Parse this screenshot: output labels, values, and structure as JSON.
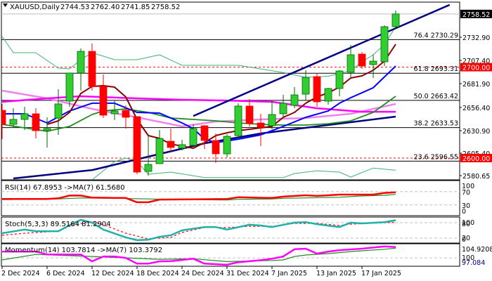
{
  "header": {
    "symbol_label": "XAUUSD,Daily",
    "open": "2744.53",
    "high": "2762.40",
    "low": "2741.85",
    "close": "2758.52"
  },
  "colors": {
    "bull": "#32cd32",
    "bull_edge": "#006400",
    "bear": "#ff0000",
    "ma_fast": "#8b0000",
    "ma_blue": "#0000ff",
    "ma_green": "#228b22",
    "ma_magenta": "#ff00ff",
    "ma_violet": "#ee82ee",
    "navy": "#000080",
    "band": "#3cb371",
    "rsi": "#ff0000",
    "stoch": "#20b2aa",
    "momentum": "#ff00ff"
  },
  "price_axis": {
    "labels": [
      "2732.90",
      "2707.40",
      "2681.90",
      "2656.40",
      "2630.90",
      "2605.40",
      "2580.65"
    ],
    "current_price": "2758.52",
    "level_2700": "2700.00",
    "level_2600": "2600.00"
  },
  "fibonacci": [
    {
      "label": "76.4 2730.29",
      "price": 2730.29
    },
    {
      "label": "61.8 2693.31",
      "price": 2693.31
    },
    {
      "label": "50.0 2663.42",
      "price": 2663.42
    },
    {
      "label": "38.2 2633.53",
      "price": 2633.53
    },
    {
      "label": "23.6 2596.55",
      "price": 2596.55
    }
  ],
  "candles": [
    [
      2652.5,
      2659.5,
      2620.8,
      2637.1
    ],
    [
      2637.1,
      2654.8,
      2633.2,
      2642.5
    ],
    [
      2642.5,
      2656.4,
      2630.9,
      2648.7
    ],
    [
      2648.7,
      2654.8,
      2621.6,
      2630.1
    ],
    [
      2630.1,
      2644.8,
      2611.6,
      2632.4
    ],
    [
      2644.0,
      2675.7,
      2625.5,
      2659.5
    ],
    [
      2662.6,
      2693.5,
      2656.4,
      2693.5
    ],
    [
      2693.5,
      2720.5,
      2674.2,
      2717.4
    ],
    [
      2717.4,
      2725.9,
      2674.2,
      2678.8
    ],
    [
      2678.8,
      2691.9,
      2644.0,
      2647.1
    ],
    [
      2648.7,
      2663.3,
      2641.7,
      2651.8
    ],
    [
      2652.5,
      2657.9,
      2632.4,
      2644.8
    ],
    [
      2645.6,
      2645.6,
      2582.2,
      2584.5
    ],
    [
      2585.3,
      2624.7,
      2580.7,
      2593.0
    ],
    [
      2593.8,
      2630.9,
      2593.8,
      2621.6
    ],
    [
      2618.5,
      2632.4,
      2606.2,
      2611.6
    ],
    [
      2610.8,
      2620.1,
      2608.5,
      2614.7
    ],
    [
      2613.9,
      2637.1,
      2613.9,
      2632.4
    ],
    [
      2635.5,
      2636.3,
      2610.0,
      2619.3
    ],
    [
      2619.3,
      2627.0,
      2594.6,
      2604.6
    ],
    [
      2604.6,
      2626.3,
      2600.8,
      2623.9
    ],
    [
      2624.7,
      2660.3,
      2620.8,
      2657.2
    ],
    [
      2657.2,
      2664.9,
      2634.8,
      2637.8
    ],
    [
      2638.6,
      2648.7,
      2613.1,
      2634.0
    ],
    [
      2635.5,
      2663.3,
      2631.7,
      2647.9
    ],
    [
      2648.7,
      2669.5,
      2644.0,
      2660.3
    ],
    [
      2657.9,
      2678.0,
      2654.8,
      2669.5
    ],
    [
      2670.3,
      2696.6,
      2663.3,
      2688.8
    ],
    [
      2689.6,
      2692.7,
      2656.4,
      2661.8
    ],
    [
      2662.6,
      2677.3,
      2658.7,
      2676.5
    ],
    [
      2676.5,
      2696.6,
      2668.0,
      2695.8
    ],
    [
      2694.3,
      2724.4,
      2688.8,
      2713.6
    ],
    [
      2714.4,
      2716.7,
      2698.1,
      2701.2
    ],
    [
      2702.8,
      2713.6,
      2688.1,
      2706.6
    ],
    [
      2705.9,
      2746.0,
      2701.2,
      2744.5
    ],
    [
      2744.53,
      2762.4,
      2741.85,
      2758.52
    ]
  ],
  "overlays": {
    "ma_fast": [
      [
        4,
        2637.1
      ],
      [
        5,
        2640.9
      ],
      [
        6,
        2650.2
      ],
      [
        7,
        2671.1
      ],
      [
        8,
        2678.8
      ],
      [
        9,
        2679.6
      ],
      [
        10,
        2678.0
      ],
      [
        11,
        2667.2
      ],
      [
        12,
        2642.5
      ],
      [
        13,
        2624.7
      ],
      [
        14,
        2621.6
      ],
      [
        15,
        2615.4
      ],
      [
        16,
        2613.1
      ],
      [
        17,
        2610.8
      ],
      [
        18,
        2617.0
      ],
      [
        19,
        2624.7
      ],
      [
        20,
        2627.8
      ],
      [
        21,
        2630.1
      ],
      [
        22,
        2631.7
      ],
      [
        23,
        2633.2
      ],
      [
        24,
        2634.8
      ],
      [
        25,
        2644.8
      ],
      [
        26,
        2650.2
      ],
      [
        27,
        2660.3
      ],
      [
        28,
        2667.2
      ],
      [
        29,
        2671.8
      ],
      [
        30,
        2678.0
      ],
      [
        31,
        2688.1
      ],
      [
        32,
        2690.4
      ],
      [
        33,
        2696.6
      ],
      [
        34,
        2706.6
      ],
      [
        35,
        2725.2
      ]
    ],
    "ma_blue": [
      [
        0,
        2648.7
      ],
      [
        2,
        2648.7
      ],
      [
        4,
        2638.6
      ],
      [
        6,
        2651.8
      ],
      [
        8,
        2660.3
      ],
      [
        10,
        2660.3
      ],
      [
        12,
        2650.2
      ],
      [
        14,
        2649.4
      ],
      [
        16,
        2638.6
      ],
      [
        17,
        2632.4
      ],
      [
        18,
        2620.8
      ],
      [
        19,
        2617.0
      ],
      [
        21,
        2620.8
      ],
      [
        23,
        2625.5
      ],
      [
        25,
        2634.8
      ],
      [
        27,
        2644.8
      ],
      [
        29,
        2651.8
      ],
      [
        30,
        2660.3
      ],
      [
        31,
        2666.4
      ],
      [
        33,
        2677.3
      ],
      [
        35,
        2701.2
      ]
    ],
    "ma_green": [
      [
        0,
        2637.1
      ],
      [
        2,
        2633.2
      ],
      [
        4,
        2629.4
      ],
      [
        6,
        2634.8
      ],
      [
        8,
        2647.9
      ],
      [
        9,
        2651.8
      ],
      [
        11,
        2654.1
      ],
      [
        13,
        2650.2
      ],
      [
        15,
        2644.0
      ],
      [
        17,
        2642.5
      ],
      [
        19,
        2640.9
      ],
      [
        21,
        2638.6
      ],
      [
        23,
        2637.1
      ],
      [
        25,
        2636.3
      ],
      [
        27,
        2636.3
      ],
      [
        29,
        2637.8
      ],
      [
        31,
        2640.9
      ],
      [
        33,
        2650.2
      ],
      [
        35,
        2668.0
      ]
    ],
    "ma_magenta": [
      [
        0,
        2661.8
      ],
      [
        4,
        2665.7
      ],
      [
        7,
        2668.0
      ],
      [
        12,
        2665.7
      ],
      [
        16,
        2664.1
      ],
      [
        20,
        2663.3
      ],
      [
        24,
        2661.8
      ],
      [
        28,
        2654.8
      ],
      [
        32,
        2650.9
      ],
      [
        35,
        2650.9
      ]
    ],
    "ma_violet": [
      [
        0,
        2674.2
      ],
      [
        4,
        2665.7
      ],
      [
        8,
        2654.1
      ],
      [
        12,
        2644.8
      ],
      [
        16,
        2634.8
      ],
      [
        19,
        2640.2
      ],
      [
        23,
        2642.5
      ],
      [
        27,
        2644.0
      ],
      [
        31,
        2648.7
      ],
      [
        35,
        2659.5
      ]
    ],
    "navy_ma": [
      [
        1,
        2577.6
      ],
      [
        8,
        2586.8
      ],
      [
        13,
        2601.5
      ],
      [
        18,
        2616.2
      ],
      [
        23,
        2627.0
      ],
      [
        28,
        2634.8
      ],
      [
        35,
        2645.6
      ]
    ],
    "channel_line": [
      [
        17,
        2646.3
      ],
      [
        39.8,
        2768.5
      ]
    ],
    "band_upper": [
      [
        0,
        2733.7
      ],
      [
        1,
        2715.9
      ],
      [
        3,
        2715.9
      ],
      [
        5,
        2698.9
      ],
      [
        6,
        2698.1
      ],
      [
        7,
        2708.2
      ],
      [
        8,
        2715.9
      ],
      [
        10,
        2708.2
      ],
      [
        12,
        2708.2
      ],
      [
        14,
        2713.6
      ],
      [
        16,
        2702.0
      ],
      [
        21,
        2702.0
      ],
      [
        25,
        2694.0
      ],
      [
        27,
        2688.8
      ],
      [
        29,
        2690.0
      ],
      [
        31,
        2696.0
      ],
      [
        32,
        2705.9
      ],
      [
        33,
        2713.6
      ],
      [
        34,
        2725.0
      ],
      [
        35,
        2744.5
      ]
    ],
    "band_lower": [
      [
        8,
        2576.0
      ],
      [
        10,
        2596.0
      ],
      [
        11,
        2600.0
      ],
      [
        12,
        2596.0
      ],
      [
        13,
        2582.2
      ],
      [
        15,
        2584.5
      ],
      [
        18,
        2578.5
      ],
      [
        25,
        2578.5
      ],
      [
        26,
        2583.0
      ],
      [
        28,
        2586.0
      ],
      [
        30,
        2584.5
      ],
      [
        31,
        2579.0
      ],
      [
        33,
        2589.0
      ],
      [
        35,
        2586.5
      ]
    ]
  },
  "rsi": {
    "label": "RSI(14) 67.8953  ->MA(7) 61.5680",
    "scale": [
      "100",
      "70",
      "30",
      "0"
    ],
    "levels": [
      70,
      30
    ],
    "values": [
      [
        0,
        48
      ],
      [
        4,
        48
      ],
      [
        5,
        50
      ],
      [
        6,
        58
      ],
      [
        7,
        58
      ],
      [
        8,
        52
      ],
      [
        10,
        51
      ],
      [
        11,
        51
      ],
      [
        12,
        38
      ],
      [
        13,
        38
      ],
      [
        14,
        46
      ],
      [
        17,
        47
      ],
      [
        20,
        48
      ],
      [
        21,
        53
      ],
      [
        24,
        51
      ],
      [
        25,
        55
      ],
      [
        27,
        59
      ],
      [
        28,
        57
      ],
      [
        29,
        59
      ],
      [
        30,
        61
      ],
      [
        33,
        61
      ],
      [
        34,
        66
      ],
      [
        35,
        67.9
      ]
    ],
    "ma": [
      [
        0,
        46
      ],
      [
        5,
        48
      ],
      [
        7,
        51
      ],
      [
        10,
        50
      ],
      [
        13,
        48
      ],
      [
        16,
        46
      ],
      [
        20,
        45
      ],
      [
        21,
        47
      ],
      [
        24,
        48
      ],
      [
        25,
        50
      ],
      [
        30,
        53
      ],
      [
        32,
        57
      ],
      [
        34,
        59
      ],
      [
        35,
        61.6
      ]
    ]
  },
  "stoch": {
    "label": "Stoch(5,3,3) 89.5164 81.2904",
    "scale": [
      "100",
      "80",
      "20",
      "0"
    ],
    "levels": [
      80,
      20
    ],
    "main": [
      [
        0,
        39
      ],
      [
        2,
        53
      ],
      [
        3,
        47
      ],
      [
        5,
        47
      ],
      [
        6,
        70
      ],
      [
        7,
        91
      ],
      [
        8,
        80
      ],
      [
        9,
        53
      ],
      [
        11,
        23
      ],
      [
        12,
        12
      ],
      [
        13,
        14
      ],
      [
        14,
        25
      ],
      [
        15,
        31
      ],
      [
        16,
        50
      ],
      [
        18,
        63
      ],
      [
        19,
        63
      ],
      [
        20,
        53
      ],
      [
        22,
        72
      ],
      [
        23,
        69
      ],
      [
        24,
        63
      ],
      [
        26,
        80
      ],
      [
        27,
        82
      ],
      [
        28,
        74
      ],
      [
        30,
        63
      ],
      [
        31,
        80
      ],
      [
        32,
        77
      ],
      [
        34,
        82
      ],
      [
        35,
        89.5
      ]
    ],
    "signal": [
      [
        0,
        31
      ],
      [
        2,
        39
      ],
      [
        5,
        47
      ],
      [
        6,
        66
      ],
      [
        8,
        85
      ],
      [
        9,
        72
      ],
      [
        11,
        39
      ],
      [
        13,
        17
      ],
      [
        15,
        23
      ],
      [
        16,
        42
      ],
      [
        18,
        61
      ],
      [
        20,
        61
      ],
      [
        22,
        66
      ],
      [
        24,
        66
      ],
      [
        26,
        77
      ],
      [
        28,
        77
      ],
      [
        30,
        69
      ],
      [
        31,
        74
      ],
      [
        35,
        81.3
      ]
    ]
  },
  "momentum": {
    "label": "Momentum(14) 103.7814  ->MA(7) 103.3792",
    "scale_max": "104.9208",
    "scale_mid": "100",
    "scale_min": "97.084",
    "range": [
      97.084,
      104.9208
    ],
    "values": [
      [
        0,
        102.2
      ],
      [
        3,
        102.2
      ],
      [
        4,
        101.2
      ],
      [
        7,
        101.2
      ],
      [
        8,
        98.8
      ],
      [
        9,
        100.5
      ],
      [
        10,
        100.5
      ],
      [
        11,
        100.0
      ],
      [
        12,
        98.0
      ],
      [
        13,
        98.0
      ],
      [
        14,
        98.8
      ],
      [
        15,
        98.85
      ],
      [
        17,
        99.7
      ],
      [
        18,
        98.0
      ],
      [
        20,
        97.6
      ],
      [
        21,
        98.5
      ],
      [
        23,
        99.2
      ],
      [
        24,
        99.7
      ],
      [
        25,
        100.5
      ],
      [
        26,
        103.0
      ],
      [
        27,
        103.2
      ],
      [
        28,
        101.5
      ],
      [
        29,
        102.2
      ],
      [
        30,
        102.7
      ],
      [
        32,
        103.2
      ],
      [
        34,
        104.0
      ],
      [
        35,
        103.8
      ]
    ],
    "ma": [
      [
        0,
        99.3
      ],
      [
        3,
        101.2
      ],
      [
        8,
        100.5
      ],
      [
        11,
        100
      ],
      [
        14,
        99.5
      ],
      [
        17,
        99.7
      ],
      [
        20,
        98.7
      ],
      [
        24,
        99.1
      ],
      [
        25,
        99.3
      ],
      [
        26,
        100.5
      ],
      [
        27,
        101
      ],
      [
        29,
        101.5
      ],
      [
        31,
        102.2
      ],
      [
        34,
        103
      ],
      [
        35,
        103.4
      ]
    ]
  },
  "time_axis": [
    {
      "index": 0,
      "label": "2 Dec 2024"
    },
    {
      "index": 4,
      "label": "6 Dec 2024"
    },
    {
      "index": 8,
      "label": "12 Dec 2024"
    },
    {
      "index": 12,
      "label": "18 Dec 2024"
    },
    {
      "index": 16,
      "label": "24 Dec 2024"
    },
    {
      "index": 20,
      "label": "31 Dec 2024"
    },
    {
      "index": 24,
      "label": "7 Jan 2025"
    },
    {
      "index": 28,
      "label": "13 Jan 2025"
    },
    {
      "index": 32,
      "label": "17 Jan 2025"
    }
  ]
}
